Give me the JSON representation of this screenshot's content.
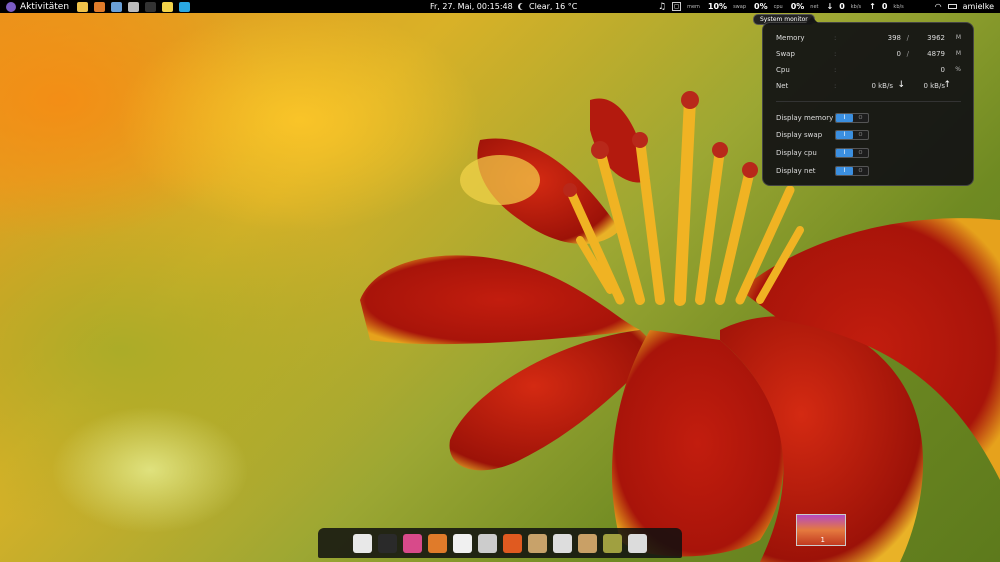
{
  "topbar": {
    "activities_label": "Aktivitäten",
    "launchers": [
      {
        "icon": "mail-icon",
        "color": "#f0c24a"
      },
      {
        "icon": "firefox-icon",
        "color": "#e07b2a"
      },
      {
        "icon": "chat-icon",
        "color": "#6aa0d8"
      },
      {
        "icon": "files-icon",
        "color": "#bbbbbb"
      },
      {
        "icon": "terminal-icon",
        "color": "#333333"
      },
      {
        "icon": "notes-icon",
        "color": "#f2d24a"
      },
      {
        "icon": "skype-icon",
        "color": "#2aa7e0"
      }
    ],
    "clock": "Fr, 27. Mai, 00:15:48",
    "weather": "Clear, 16 °C",
    "status": {
      "mem_label": "mem",
      "mem_value": "10%",
      "swap_label": "swap",
      "swap_value": "0%",
      "cpu_label": "cpu",
      "cpu_value": "0%",
      "net_label": "net",
      "net_down": "0",
      "net_down_unit": "kb/s",
      "net_up": "0",
      "net_up_unit": "kb/s"
    },
    "username": "amielke"
  },
  "tooltip": "System monitor",
  "sysmon": {
    "rows": [
      {
        "label": "Memory",
        "v1": "398",
        "v2": "3962",
        "unit": "M"
      },
      {
        "label": "Swap",
        "v1": "0",
        "v2": "4879",
        "unit": "M"
      },
      {
        "label": "Cpu",
        "v1": "",
        "v2": "0",
        "unit": "%"
      },
      {
        "label": "Net",
        "v1": "0 kB/s",
        "v2": "0 kB/s",
        "unit": ""
      }
    ],
    "toggles": [
      {
        "label": "Display memory",
        "on": "I",
        "off": "O"
      },
      {
        "label": "Display swap",
        "on": "I",
        "off": "O"
      },
      {
        "label": "Display cpu",
        "on": "I",
        "off": "O"
      },
      {
        "label": "Display net",
        "on": "I",
        "off": "O"
      }
    ]
  },
  "dock": {
    "items": [
      {
        "icon": "text-editor-icon",
        "color": "#e8e8e8"
      },
      {
        "icon": "terminal-icon",
        "color": "#2a2a2a"
      },
      {
        "icon": "color-picker-icon",
        "color": "#d84a8a"
      },
      {
        "icon": "firefox-icon",
        "color": "#e07b2a"
      },
      {
        "icon": "chat-icon",
        "color": "#f0f0f0"
      },
      {
        "icon": "files-icon",
        "color": "#cccccc"
      },
      {
        "icon": "software-center-icon",
        "color": "#e05a20"
      },
      {
        "icon": "archive-icon",
        "color": "#c8a26a"
      },
      {
        "icon": "sound-icon",
        "color": "#dddddd"
      },
      {
        "icon": "home-folder-icon",
        "color": "#c9a066"
      },
      {
        "icon": "image-viewer-icon",
        "color": "#a0a040"
      },
      {
        "icon": "settings-window-icon",
        "color": "#dcdcdc"
      }
    ]
  },
  "workspace": {
    "number": "1"
  }
}
